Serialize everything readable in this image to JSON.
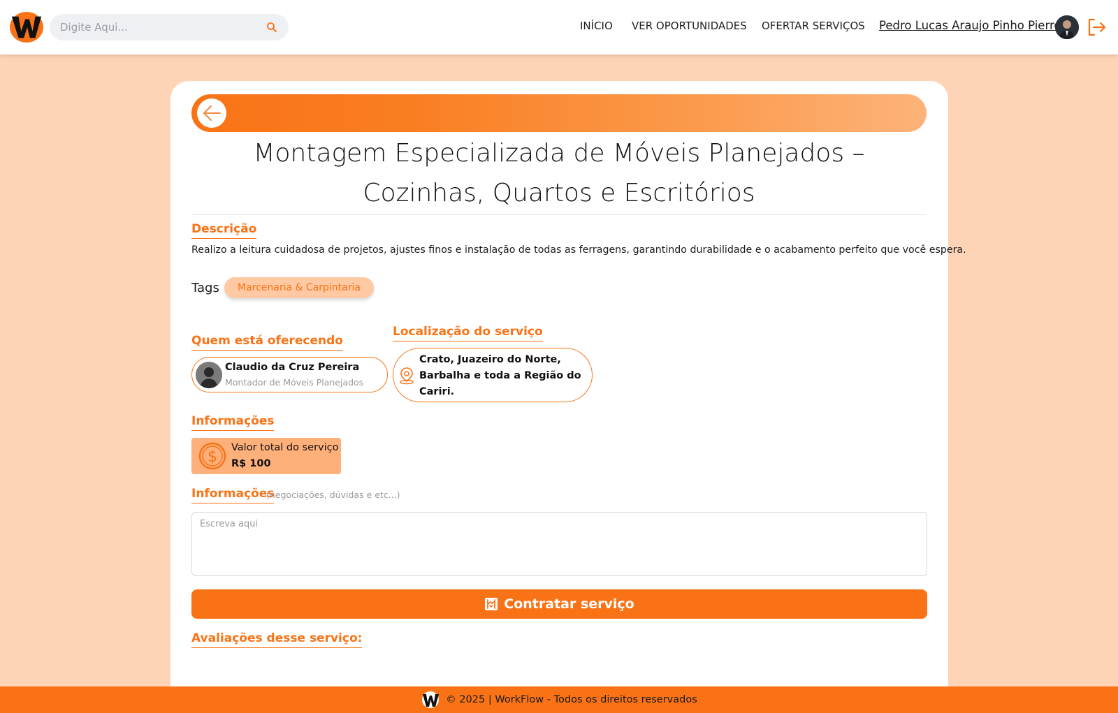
{
  "header": {
    "search_placeholder": "Digite Aqui...",
    "nav": {
      "inicio": "INÍCIO",
      "ver_oportunidades": "VER OPORTUNIDADES",
      "ofertar_servicos": "OFERTAR SERVIÇOS"
    },
    "user_name": "Pedro Lucas Araujo Pinho Pierre"
  },
  "service": {
    "title": "Montagem Especializada de Móveis Planejados – Cozinhas, Quartos e Escritórios",
    "description_label": "Descrição",
    "description": "Realizo a leitura cuidadosa de projetos, ajustes finos e instalação de todas as ferragens, garantindo durabilidade e o acabamento perfeito que você espera.",
    "tags_label": "Tags",
    "tags": [
      "Marcenaria & Carpintaria"
    ],
    "provider_label": "Quem está oferecendo",
    "provider": {
      "name": "Claudio da Cruz Pereira",
      "role": "Montador de Móveis Planejados"
    },
    "location_label": "Localização do serviço",
    "location": "Crato, Juazeiro do Norte, Barbalha e toda a Região do Cariri.",
    "info_label": "Informações",
    "price_label": "Valor total do serviço",
    "price_value": "R$ 100",
    "message_label": "Informações",
    "message_hint": "(negociações, dúvidas e etc...)",
    "message_placeholder": "Escreva aqui",
    "hire_button": "Contratar serviço",
    "reviews_label": "Avaliações desse serviço:"
  },
  "footer": {
    "text": "© 2025 | WorkFlow - Todos os direitos reservados"
  },
  "colors": {
    "accent": "#f97316",
    "background": "#ffd3b6",
    "tag_bg": "#ffc9a3",
    "price_bg": "#fdb07a"
  },
  "icons": [
    "search-icon",
    "logout-icon",
    "back-arrow-icon",
    "location-pin-icon",
    "coin-icon",
    "handshake-icon",
    "workflow-logo"
  ]
}
